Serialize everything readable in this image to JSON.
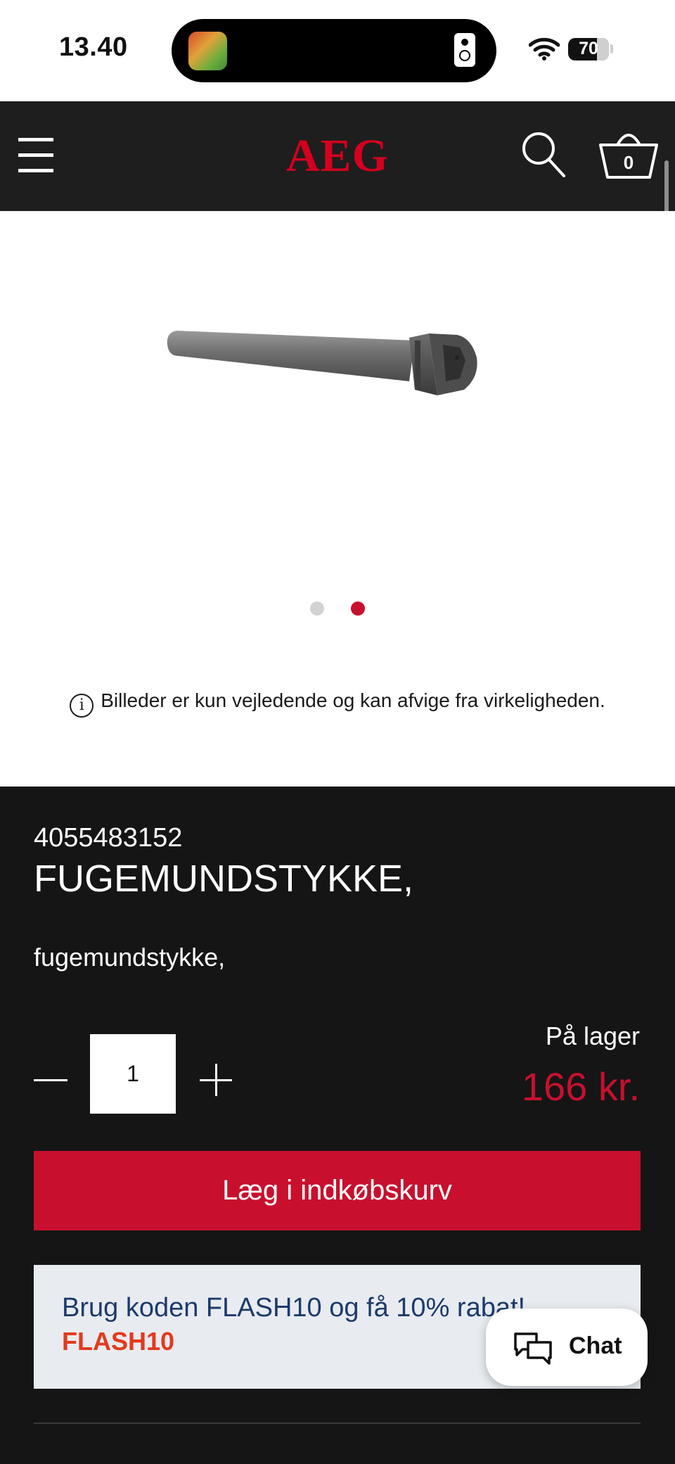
{
  "status_bar": {
    "time": "13.40",
    "battery": "70",
    "battery_level": 0.7
  },
  "header": {
    "logo": "AEG",
    "cart_count": "0"
  },
  "gallery": {
    "slide_count": 2,
    "active_slide": 2,
    "disclaimer": "Billeder er kun vejledende og kan afvige fra virkeligheden."
  },
  "product": {
    "sku": "4055483152",
    "title": "FUGEMUNDSTYKKE,",
    "description": "fugemundstykke,",
    "quantity": "1",
    "stock": "På lager",
    "price": "166 kr.",
    "add_to_cart": "Læg i indkøbskurv"
  },
  "promo": {
    "text": "Brug koden FLASH10 og få 10% rabat!",
    "code": "FLASH10"
  },
  "chat": {
    "label": "Chat"
  },
  "colors": {
    "brand": "#c8102e",
    "background": "#151515",
    "promo_text": "#1d3a6b",
    "promo_code": "#e33a1d"
  }
}
